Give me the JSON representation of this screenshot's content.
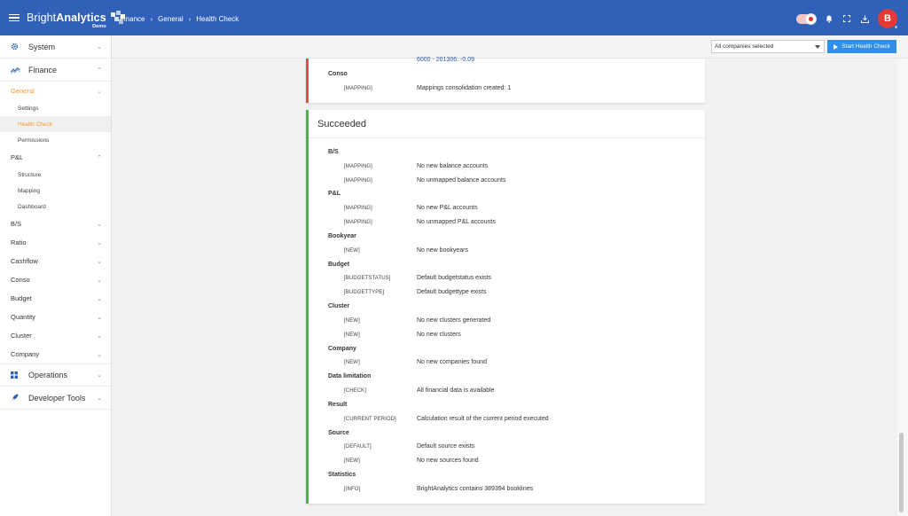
{
  "brand": {
    "name_light": "Bright",
    "name_bold": "Analytics",
    "sub": "Demo"
  },
  "breadcrumb": [
    "Finance",
    "General",
    "Health Check"
  ],
  "avatar_initial": "B",
  "colors": {
    "header": "#3060b8",
    "accent": "#f59a2d",
    "success": "#4caf50",
    "failure": "#d9534f",
    "button": "#2f8ee5",
    "avatar": "#e53935"
  },
  "sidebar": {
    "system": "System",
    "finance": "Finance",
    "general": "General",
    "general_items": [
      "Settings",
      "Health Check",
      "Permissions"
    ],
    "pl": "P&L",
    "pl_items": [
      "Structure",
      "Mapping",
      "Dashboard"
    ],
    "groups": [
      "B/S",
      "Ratio",
      "Cashflow",
      "Conso",
      "Budget",
      "Quantity",
      "Cluster",
      "Company"
    ],
    "operations": "Operations",
    "developer_tools": "Developer Tools"
  },
  "filter": {
    "select_value": "All companies selected",
    "start_button": "Start Health Check"
  },
  "failed_card": {
    "top_text": "6000 - 201306: -0.09",
    "category": "Conso",
    "tag": "[MAPPING]",
    "message": "Mappings consolidation created: 1"
  },
  "succeeded": {
    "title": "Succeeded",
    "rows": [
      {
        "type": "cat",
        "text": "B/S"
      },
      {
        "type": "item",
        "tag": "[MAPPING]",
        "message": "No new balance accounts"
      },
      {
        "type": "item",
        "tag": "[MAPPING]",
        "message": "No unmapped balance accounts"
      },
      {
        "type": "cat",
        "text": "P&L"
      },
      {
        "type": "item",
        "tag": "[MAPPING]",
        "message": "No new P&L accounts"
      },
      {
        "type": "item",
        "tag": "[MAPPING]",
        "message": "No unmapped P&L accounts"
      },
      {
        "type": "cat",
        "text": "Bookyear"
      },
      {
        "type": "item",
        "tag": "[NEW]",
        "message": "No new bookyears"
      },
      {
        "type": "cat",
        "text": "Budget"
      },
      {
        "type": "item",
        "tag": "[BUDGETSTATUS]",
        "message": "Default budgetstatus exists"
      },
      {
        "type": "item",
        "tag": "[BUDGETTYPE]",
        "message": "Default budgettype exists"
      },
      {
        "type": "cat",
        "text": "Cluster"
      },
      {
        "type": "item",
        "tag": "[NEW]",
        "message": "No new clusters generated"
      },
      {
        "type": "item",
        "tag": "[NEW]",
        "message": "No new clusters"
      },
      {
        "type": "cat",
        "text": "Company"
      },
      {
        "type": "item",
        "tag": "[NEW]",
        "message": "No new companies found"
      },
      {
        "type": "cat",
        "text": "Data limitation"
      },
      {
        "type": "item",
        "tag": "[CHECK]",
        "message": "All financial data is available"
      },
      {
        "type": "cat",
        "text": "Result"
      },
      {
        "type": "item",
        "tag": "[CURRENT PERIOD]",
        "message": "Calculation result of the current period executed"
      },
      {
        "type": "cat",
        "text": "Source"
      },
      {
        "type": "item",
        "tag": "[DEFAULT]",
        "message": "Default source exists"
      },
      {
        "type": "item",
        "tag": "[NEW]",
        "message": "No new sources found"
      },
      {
        "type": "cat",
        "text": "Statistics"
      },
      {
        "type": "item",
        "tag": "[INFO]",
        "message": "BrightAnalytics contains 389394 booklines"
      }
    ]
  }
}
